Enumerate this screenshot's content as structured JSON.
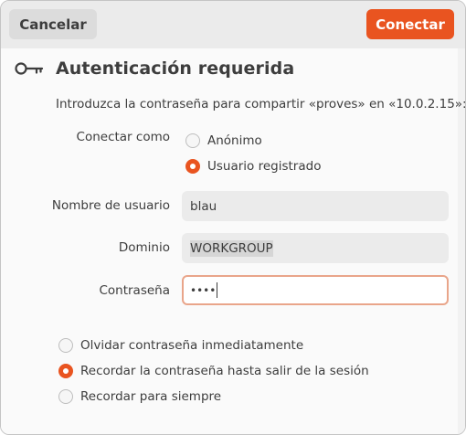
{
  "header": {
    "cancel_label": "Cancelar",
    "connect_label": "Conectar"
  },
  "dialog": {
    "title": "Autenticación requerida",
    "icon": "key-icon",
    "intro": "Introduzca la contraseña para compartir «proves» en «10.0.2.15»:"
  },
  "form": {
    "connect_as_label": "Conectar como",
    "connect_as_options": [
      {
        "label": "Anónimo",
        "checked": false
      },
      {
        "label": "Usuario registrado",
        "checked": true
      }
    ],
    "username_label": "Nombre de usuario",
    "username_value": "blau",
    "domain_label": "Dominio",
    "domain_value": "WORKGROUP",
    "password_label": "Contraseña",
    "password_masked": "••••"
  },
  "remember": {
    "options": [
      {
        "label": "Olvidar contraseña inmediatamente",
        "checked": false
      },
      {
        "label": "Recordar la contraseña hasta salir de la sesión",
        "checked": true
      },
      {
        "label": "Recordar para siempre",
        "checked": false
      }
    ]
  },
  "colors": {
    "accent": "#e95420",
    "focus_border": "#e9a58a",
    "headerbar": "#ebebeb",
    "text": "#3d3d3d"
  }
}
